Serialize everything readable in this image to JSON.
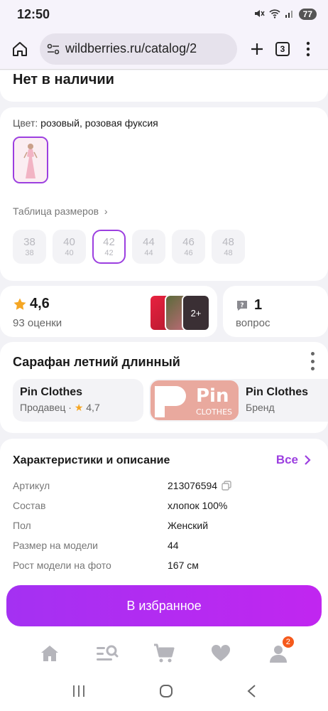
{
  "status_bar": {
    "time": "12:50",
    "battery": "77"
  },
  "browser": {
    "url": "wildberries.ru/catalog/2",
    "tab_count": "3"
  },
  "availability": {
    "title": "Нет в наличии"
  },
  "color": {
    "label": "Цвет:",
    "value": "розовый, розовая фуксия"
  },
  "sizes": {
    "table_link": "Таблица размеров",
    "items": [
      {
        "top": "38",
        "bottom": "38"
      },
      {
        "top": "40",
        "bottom": "40"
      },
      {
        "top": "42",
        "bottom": "42"
      },
      {
        "top": "44",
        "bottom": "44"
      },
      {
        "top": "46",
        "bottom": "46"
      },
      {
        "top": "48",
        "bottom": "48"
      }
    ],
    "selected": "42"
  },
  "rating": {
    "value": "4,6",
    "count_label": "93 оценки",
    "more_photos": "2+"
  },
  "questions": {
    "count": "1",
    "label": "вопрос"
  },
  "product": {
    "title": "Сарафан летний длинный"
  },
  "seller": {
    "name": "Pin Clothes",
    "label": "Продавец ·",
    "rating": "4,7"
  },
  "brand": {
    "name": "Pin Clothes",
    "label": "Бренд",
    "logo_text": "Pin",
    "logo_sub": "CLOTHES"
  },
  "characteristics": {
    "title": "Характеристики и описание",
    "all_link": "Все",
    "rows": [
      {
        "key": "Артикул",
        "value": "213076594"
      },
      {
        "key": "Состав",
        "value": "хлопок 100%"
      },
      {
        "key": "Пол",
        "value": "Женский"
      },
      {
        "key": "Размер на модели",
        "value": "44"
      },
      {
        "key": "Рост модели на фото",
        "value": "167 см"
      }
    ]
  },
  "actions": {
    "favorite_label": "В избранное"
  },
  "tabbar": {
    "cart_badge": "2"
  },
  "colors": {
    "accent": "#9c3fe0",
    "badge": "#f55a1c",
    "star": "#f5a623"
  }
}
